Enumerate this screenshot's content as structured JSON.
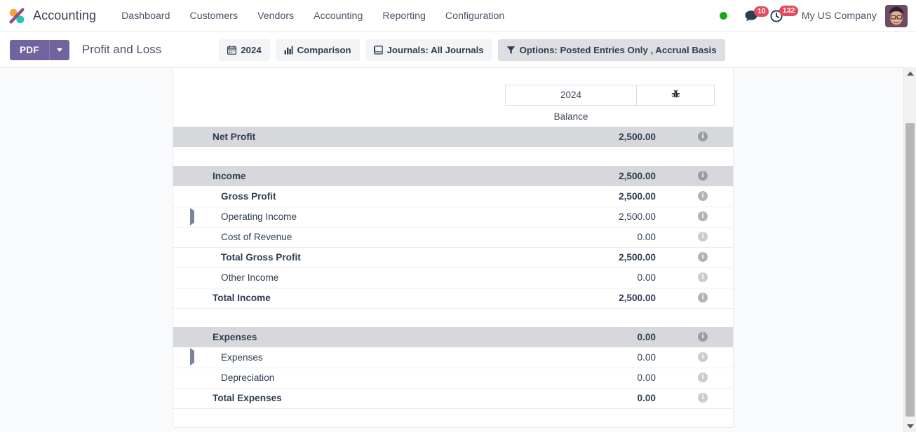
{
  "navbar": {
    "brand": "Accounting",
    "logo_colors": {
      "orange": "#f0a43c",
      "purple": "#8f4f8b",
      "teal": "#22c5b0"
    },
    "menu": [
      {
        "label": "Dashboard"
      },
      {
        "label": "Customers"
      },
      {
        "label": "Vendors"
      },
      {
        "label": "Accounting"
      },
      {
        "label": "Reporting"
      },
      {
        "label": "Configuration"
      }
    ],
    "status_indicator": {
      "name": "online-status-dot",
      "color": "#17a81a"
    },
    "messages": {
      "icon": "chat-icon",
      "count": "10"
    },
    "activities": {
      "icon": "clock-icon",
      "count": "132"
    },
    "company": "My US Company",
    "avatar": "user-avatar",
    "badge_color": "#e44c5e"
  },
  "control_panel": {
    "pdf_label": "PDF",
    "pdf_color": "#71639e",
    "report_title": "Profit and Loss",
    "filters": [
      {
        "icon": "calendar-icon",
        "glyph": "Ὄ5",
        "label": "2024",
        "active": false,
        "name": "date-filter"
      },
      {
        "icon": "chart-bar-icon",
        "glyph": "",
        "label": "Comparison",
        "active": false,
        "name": "comparison-filter"
      },
      {
        "icon": "book-icon",
        "glyph": "",
        "label": "Journals: All Journals",
        "active": false,
        "name": "journals-filter"
      },
      {
        "icon": "funnel-icon",
        "glyph": "",
        "label": "Options: Posted Entries Only , Accrual Basis",
        "active": true,
        "name": "options-filter"
      }
    ]
  },
  "report": {
    "columns": {
      "period": "2024",
      "debug_icon": "bug-icon",
      "subheader": "Balance"
    },
    "rows": [
      {
        "id": "net_profit",
        "label": "Net Profit",
        "value": "2,500.00",
        "bold": true,
        "shaded": true,
        "indent": 0,
        "caret": false,
        "muted": false,
        "spacer_after": true,
        "border": false
      },
      {
        "id": "income",
        "label": "Income",
        "value": "2,500.00",
        "bold": true,
        "shaded": true,
        "indent": 0,
        "caret": false,
        "muted": false,
        "spacer_after": false,
        "border": false
      },
      {
        "id": "gross_profit",
        "label": "Gross Profit",
        "value": "2,500.00",
        "bold": true,
        "shaded": false,
        "indent": 1,
        "caret": false,
        "muted": false,
        "spacer_after": false,
        "border": true
      },
      {
        "id": "operating_income",
        "label": "Operating Income",
        "value": "2,500.00",
        "bold": false,
        "shaded": false,
        "indent": 2,
        "caret": true,
        "muted": false,
        "spacer_after": false,
        "border": true
      },
      {
        "id": "cost_of_revenue",
        "label": "Cost of Revenue",
        "value": "0.00",
        "bold": false,
        "shaded": false,
        "indent": 2,
        "caret": false,
        "muted": true,
        "spacer_after": false,
        "border": true
      },
      {
        "id": "total_gross",
        "label": "Total Gross Profit",
        "value": "2,500.00",
        "bold": true,
        "shaded": false,
        "indent": 1,
        "caret": false,
        "muted": false,
        "spacer_after": false,
        "border": true
      },
      {
        "id": "other_income",
        "label": "Other Income",
        "value": "0.00",
        "bold": false,
        "shaded": false,
        "indent": 2,
        "caret": false,
        "muted": true,
        "spacer_after": false,
        "border": true
      },
      {
        "id": "total_income",
        "label": "Total Income",
        "value": "2,500.00",
        "bold": true,
        "shaded": false,
        "indent": 0,
        "caret": false,
        "muted": false,
        "spacer_after": true,
        "border": true
      },
      {
        "id": "expenses_head",
        "label": "Expenses",
        "value": "0.00",
        "bold": true,
        "shaded": true,
        "indent": 0,
        "caret": false,
        "muted": true,
        "spacer_after": false,
        "border": false
      },
      {
        "id": "expenses_sub",
        "label": "Expenses",
        "value": "0.00",
        "bold": false,
        "shaded": false,
        "indent": 2,
        "caret": true,
        "muted": true,
        "spacer_after": false,
        "border": true
      },
      {
        "id": "depreciation",
        "label": "Depreciation",
        "value": "0.00",
        "bold": false,
        "shaded": false,
        "indent": 2,
        "caret": false,
        "muted": true,
        "spacer_after": false,
        "border": true
      },
      {
        "id": "total_expenses",
        "label": "Total Expenses",
        "value": "0.00",
        "bold": true,
        "shaded": false,
        "indent": 0,
        "caret": false,
        "muted": true,
        "spacer_after": false,
        "border": true
      }
    ]
  },
  "scrollbar": {
    "name": "vertical-scrollbar",
    "up": "scroll-up-arrow",
    "down": "scroll-down-arrow"
  }
}
